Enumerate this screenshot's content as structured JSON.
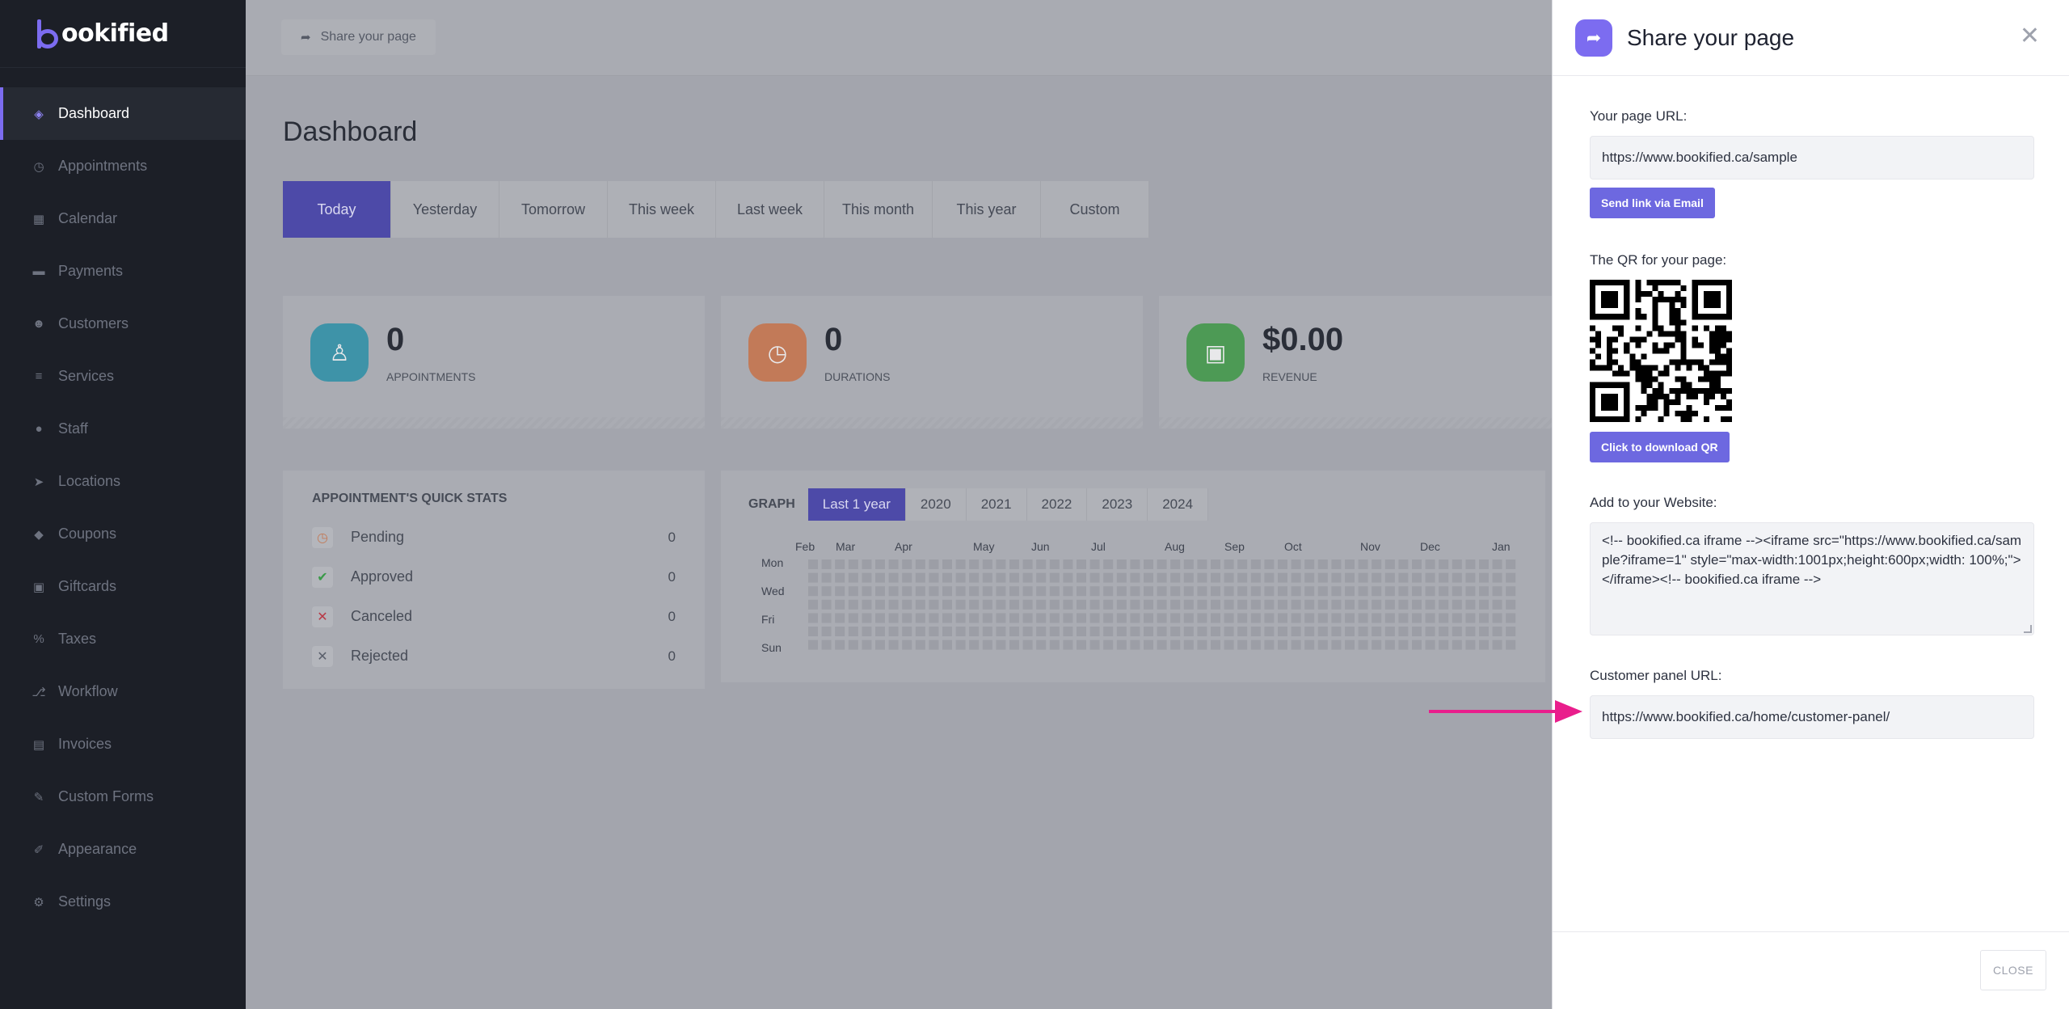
{
  "brand": {
    "name": "ookified"
  },
  "sidebar": {
    "items": [
      {
        "label": "Dashboard",
        "icon": "cube-icon",
        "glyph": "◈"
      },
      {
        "label": "Appointments",
        "icon": "clock-icon",
        "glyph": "◷"
      },
      {
        "label": "Calendar",
        "icon": "calendar-icon",
        "glyph": "▦"
      },
      {
        "label": "Payments",
        "icon": "wallet-icon",
        "glyph": "▬"
      },
      {
        "label": "Customers",
        "icon": "users-icon",
        "glyph": "☻"
      },
      {
        "label": "Services",
        "icon": "list-icon",
        "glyph": "≡"
      },
      {
        "label": "Staff",
        "icon": "user-icon",
        "glyph": "●"
      },
      {
        "label": "Locations",
        "icon": "location-arrow-icon",
        "glyph": "➤"
      },
      {
        "label": "Coupons",
        "icon": "tag-icon",
        "glyph": "◆"
      },
      {
        "label": "Giftcards",
        "icon": "gift-icon",
        "glyph": "▣"
      },
      {
        "label": "Taxes",
        "icon": "percent-icon",
        "glyph": "%"
      },
      {
        "label": "Workflow",
        "icon": "workflow-icon",
        "glyph": "⎇"
      },
      {
        "label": "Invoices",
        "icon": "file-icon",
        "glyph": "▤"
      },
      {
        "label": "Custom Forms",
        "icon": "magic-wand-icon",
        "glyph": "✎"
      },
      {
        "label": "Appearance",
        "icon": "brush-icon",
        "glyph": "✐"
      },
      {
        "label": "Settings",
        "icon": "gear-icon",
        "glyph": "⚙"
      }
    ]
  },
  "topbar": {
    "share_label": "Share your page",
    "share_glyph": "➦"
  },
  "dashboard": {
    "title": "Dashboard",
    "tabs": [
      "Today",
      "Yesterday",
      "Tomorrow",
      "This week",
      "Last week",
      "This month",
      "This year",
      "Custom"
    ],
    "stats": [
      {
        "value": "0",
        "label": "APPOINTMENTS",
        "icon": "user-icon",
        "glyph": "♙",
        "color": "#3e93a8"
      },
      {
        "value": "0",
        "label": "DURATIONS",
        "icon": "clock-icon",
        "glyph": "◷",
        "color": "#c27a58"
      },
      {
        "value": "$0.00",
        "label": "REVENUE",
        "icon": "wallet-icon",
        "glyph": "▣",
        "color": "#4d9a55"
      }
    ],
    "quick_stats": {
      "title": "APPOINTMENT'S QUICK STATS",
      "rows": [
        {
          "label": "Pending",
          "count": "0",
          "icon": "clock-icon",
          "glyph": "◷",
          "color": "#c27a58"
        },
        {
          "label": "Approved",
          "count": "0",
          "icon": "check-icon",
          "glyph": "✔",
          "color": "#3a9a48"
        },
        {
          "label": "Canceled",
          "count": "0",
          "icon": "x-icon",
          "glyph": "✕",
          "color": "#b83a46"
        },
        {
          "label": "Rejected",
          "count": "0",
          "icon": "x-icon",
          "glyph": "✕",
          "color": "#5a5f6b"
        }
      ]
    },
    "graph": {
      "title": "GRAPH",
      "ranges": [
        "Last 1 year",
        "2020",
        "2021",
        "2022",
        "2023",
        "2024"
      ],
      "months": [
        "Feb",
        "Mar",
        "Apr",
        "May",
        "Jun",
        "Jul",
        "Aug",
        "Sep",
        "Oct",
        "Nov",
        "Dec",
        "Jan"
      ],
      "days": [
        "Mon",
        "Wed",
        "Fri",
        "Sun"
      ]
    }
  },
  "panel": {
    "title": "Share your page",
    "page_url_label": "Your page URL:",
    "page_url": "https://www.bookified.ca/sample",
    "send_email_label": "Send link via Email",
    "qr_label": "The QR for your page:",
    "download_qr_label": "Click to download QR",
    "embed_label": "Add to your Website:",
    "embed_code": "<!-- bookified.ca iframe --><iframe src=\"https://www.bookified.ca/sample?iframe=1\" style=\"max-width:1001px;height:600px;width: 100%;\"></iframe><!-- bookified.ca iframe -->",
    "customer_panel_label": "Customer panel URL:",
    "customer_panel_url": "https://www.bookified.ca/home/customer-panel/",
    "close_label": "CLOSE"
  },
  "colors": {
    "accent": "#7c6cf0",
    "pointer": "#e91e8c"
  }
}
